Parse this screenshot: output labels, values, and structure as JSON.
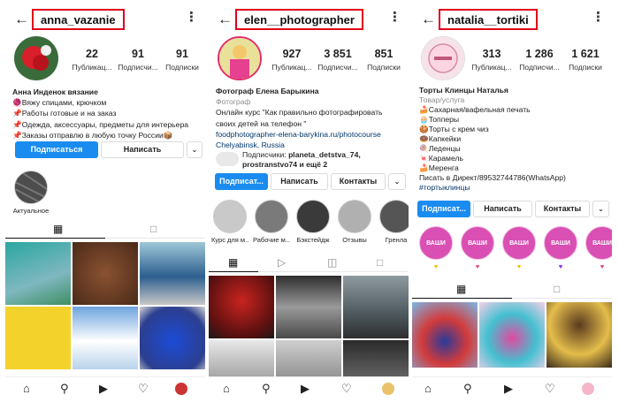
{
  "profiles": [
    {
      "username": "anna_vazanie",
      "stats": [
        {
          "value": "22",
          "label": "Публикац..."
        },
        {
          "value": "91",
          "label": "Подписчи..."
        },
        {
          "value": "91",
          "label": "Подписки"
        }
      ],
      "bio": [
        "Анна Инденок вязание",
        "🧶Вяжу спицами, крючком",
        "📌Работы готовые и на заказ",
        "📌Одежда, аксессуары, предметы для интерьера",
        "📌Заказы отправлю в любую точку России📦"
      ],
      "buttons": {
        "primary": "Подписаться",
        "message": "Написать"
      },
      "highlights": [
        {
          "label": "Актуальное"
        }
      ]
    },
    {
      "username": "elen__photographer",
      "stats": [
        {
          "value": "927",
          "label": "Публикац..."
        },
        {
          "value": "3 851",
          "label": "Подписчи..."
        },
        {
          "value": "851",
          "label": "Подписки"
        }
      ],
      "bio": [
        "Фотограф Елена Барыкина",
        "Фотограф",
        "Онлайн курс \"Как правильно фотографировать",
        "своих детей на телефон \"",
        "foodphotographer-elena-barykina.ru/photocourse",
        "Chelyabinsk, Russia"
      ],
      "followed_by": {
        "prefix": "Подписчики:",
        "names": "planeta_detstva_74,",
        "rest": "prostranstvo74 и ещё 2"
      },
      "buttons": {
        "primary": "Подписат...",
        "message": "Написать",
        "contacts": "Контакты"
      },
      "highlights": [
        {
          "label": "Курс для м..."
        },
        {
          "label": "Рабочие м..."
        },
        {
          "label": "Бэкстейдж"
        },
        {
          "label": "Отзывы"
        },
        {
          "label": "Гренла"
        }
      ]
    },
    {
      "username": "natalia__tortiki",
      "stats": [
        {
          "value": "313",
          "label": "Публикац..."
        },
        {
          "value": "1 286",
          "label": "Подписчи..."
        },
        {
          "value": "1 621",
          "label": "Подписки"
        }
      ],
      "bio": [
        "Торты Клинцы Наталья",
        "Товар/услуга",
        "🍰Сахарная/вафельная печать",
        "🧁Топперы",
        "🍪Торты с крем чиз",
        "🍩Капкейки",
        "🍭Леденцы",
        "🍬Карамель",
        "🍰Меренга",
        "Писать в Директ/89532744786(WhatsApp)",
        "#тортыклинцы"
      ],
      "buttons": {
        "primary": "Подписат...",
        "message": "Написать",
        "contacts": "Контакты"
      },
      "highlights": [
        {
          "label": "ВАШИ"
        },
        {
          "label": "ВАШИ"
        },
        {
          "label": "ВАШИ"
        },
        {
          "label": "ВАШИ"
        },
        {
          "label": "ВАШИ"
        }
      ]
    }
  ],
  "icons": {
    "back": "arrow-left-icon",
    "menu": "more-vertical-icon",
    "grid": "grid-icon",
    "tagged": "tagged-icon",
    "reels": "reels-icon",
    "igtv": "igtv-icon",
    "home": "home-icon",
    "search": "search-icon",
    "heart": "heart-icon"
  },
  "colors": {
    "accent_blue": "#1a8cf0",
    "highlight_red": "#e0001b"
  }
}
